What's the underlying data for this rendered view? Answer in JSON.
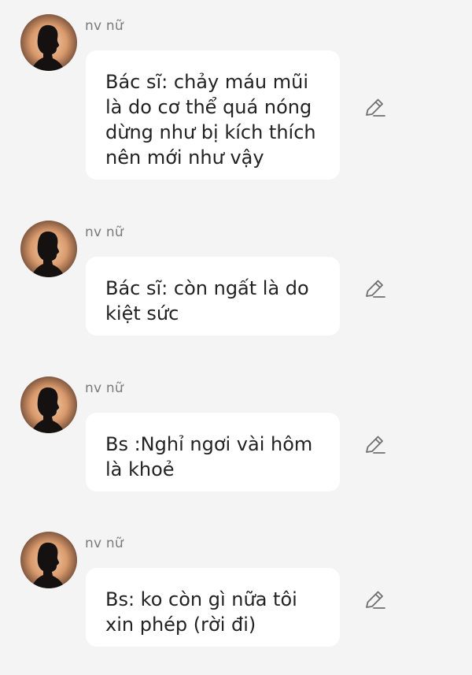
{
  "messages": [
    {
      "sender": "nv nữ",
      "text": "Bác sĩ: chảy máu mũi\nlà do cơ thể quá nóng\ndừng như bị kích thích\nnên mới như vậy",
      "avatar_icon": "person-silhouette-icon",
      "action_icon": "edit-pencil-icon"
    },
    {
      "sender": "nv nữ",
      "text": "Bác sĩ: còn ngất là do\nkiệt sức",
      "avatar_icon": "person-silhouette-icon",
      "action_icon": "edit-pencil-icon"
    },
    {
      "sender": "nv nữ",
      "text": "Bs :Nghỉ ngơi vài hôm\nlà khoẻ",
      "avatar_icon": "person-silhouette-icon",
      "action_icon": "edit-pencil-icon"
    },
    {
      "sender": "nv nữ",
      "text": "Bs: ko còn gì nữa tôi\nxin phép (rời đi)",
      "avatar_icon": "person-silhouette-icon",
      "action_icon": "edit-pencil-icon"
    }
  ],
  "colors": {
    "background": "#f4f4f4",
    "bubble": "#ffffff",
    "sender_text": "#7a7a7a",
    "message_text": "#222222"
  }
}
